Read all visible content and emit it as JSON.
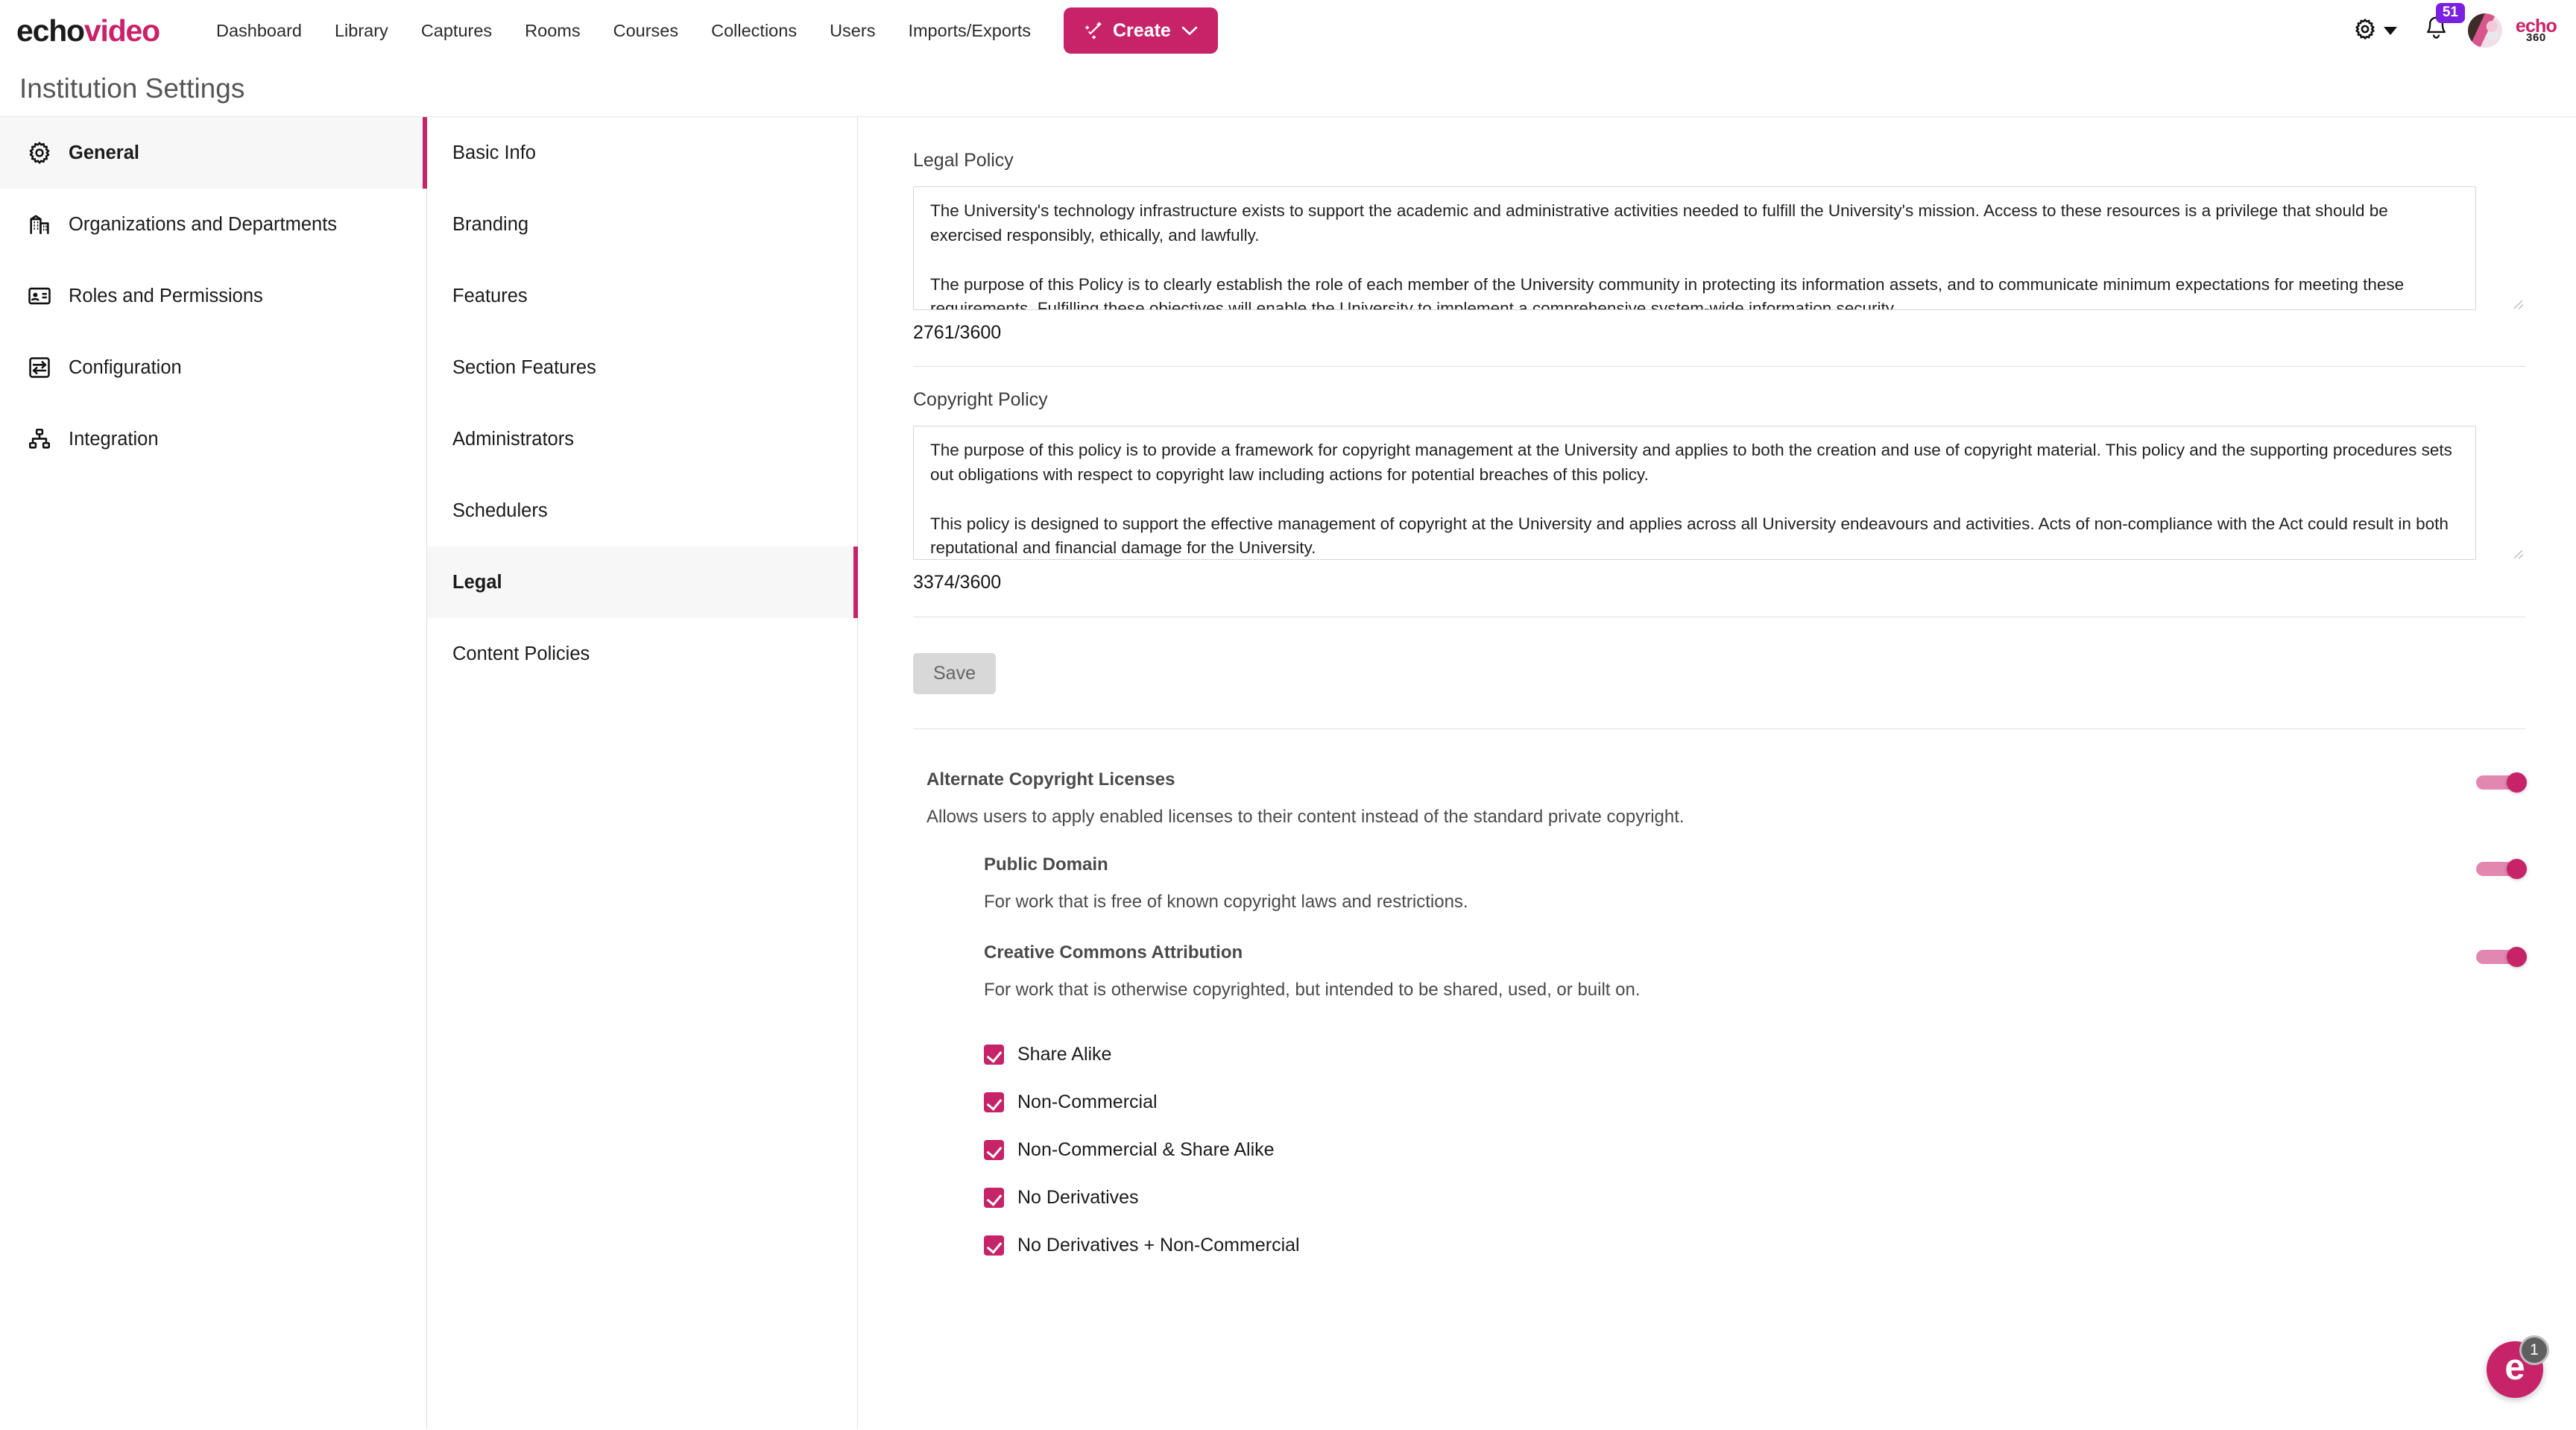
{
  "brand": {
    "logo_primary": "echo",
    "logo_accent": "video",
    "accent_color": "#c62368",
    "badge_color": "#7b1fe0",
    "secondary_logo_top": "echo",
    "secondary_logo_bottom": "360"
  },
  "topnav": {
    "items": [
      {
        "label": "Dashboard"
      },
      {
        "label": "Library"
      },
      {
        "label": "Captures"
      },
      {
        "label": "Rooms"
      },
      {
        "label": "Courses"
      },
      {
        "label": "Collections"
      },
      {
        "label": "Users"
      },
      {
        "label": "Imports/Exports"
      }
    ],
    "create_label": "Create",
    "notification_count": "51",
    "gear_icon": "gear-icon",
    "bell_icon": "bell-icon",
    "chevron_icon": "chevron-down-icon"
  },
  "page": {
    "title": "Institution Settings"
  },
  "sidebar": {
    "items": [
      {
        "label": "General",
        "icon": "gear-icon",
        "active": true
      },
      {
        "label": "Organizations and Departments",
        "icon": "building-icon",
        "active": false
      },
      {
        "label": "Roles and Permissions",
        "icon": "id-card-icon",
        "active": false
      },
      {
        "label": "Configuration",
        "icon": "sliders-icon",
        "active": false
      },
      {
        "label": "Integration",
        "icon": "sitemap-icon",
        "active": false
      }
    ]
  },
  "subnav": {
    "items": [
      {
        "label": "Basic Info",
        "active": false
      },
      {
        "label": "Branding",
        "active": false
      },
      {
        "label": "Features",
        "active": false
      },
      {
        "label": "Section Features",
        "active": false
      },
      {
        "label": "Administrators",
        "active": false
      },
      {
        "label": "Schedulers",
        "active": false
      },
      {
        "label": "Legal",
        "active": true
      },
      {
        "label": "Content Policies",
        "active": false
      }
    ]
  },
  "legal_policy": {
    "label": "Legal Policy",
    "value": "The University's technology infrastructure exists to support the academic and administrative activities needed to fulfill the University's mission. Access to these resources is a privilege that should be exercised responsibly, ethically, and lawfully.\n\nThe purpose of this Policy is to clearly establish the role of each member of the University community in protecting its information assets, and to communicate minimum expectations for meeting these requirements. Fulfilling these objectives will enable the University to implement a comprehensive system-wide information security",
    "counter": "2761/3600",
    "char_count": 2761,
    "char_limit": 3600
  },
  "copyright_policy": {
    "label": "Copyright Policy",
    "value": "The purpose of this policy is to provide a framework for copyright management at the University and applies to both the creation and use of copyright material. This policy and the supporting procedures sets out obligations with respect to copyright law including actions for potential breaches of this policy.\n\nThis policy is designed to support the effective management of copyright at the University and applies across all University endeavours and activities. Acts of non-compliance with the Act could result in both reputational and financial damage for the University.",
    "counter": "3374/3600",
    "char_count": 3374,
    "char_limit": 3600,
    "misspelled_word": "endeavours"
  },
  "save": {
    "label": "Save",
    "disabled": true
  },
  "licenses": {
    "section_title": "Alternate Copyright Licenses",
    "section_desc": "Allows users to apply enabled licenses to their content instead of the standard private copyright.",
    "section_toggle_on": true,
    "items": [
      {
        "title": "Public Domain",
        "desc": "For work that is free of known copyright laws and restrictions.",
        "toggle_on": true
      },
      {
        "title": "Creative Commons Attribution",
        "desc": "For work that is otherwise copyrighted, but intended to be shared, used, or built on.",
        "toggle_on": true
      }
    ],
    "checkboxes": [
      {
        "label": "Share Alike",
        "checked": true
      },
      {
        "label": "Non-Commercial",
        "checked": true
      },
      {
        "label": "Non-Commercial & Share Alike",
        "checked": true
      },
      {
        "label": "No Derivatives",
        "checked": true
      },
      {
        "label": "No Derivatives + Non-Commercial",
        "checked": true
      }
    ]
  },
  "help_widget": {
    "glyph": "e",
    "badge": "1"
  }
}
